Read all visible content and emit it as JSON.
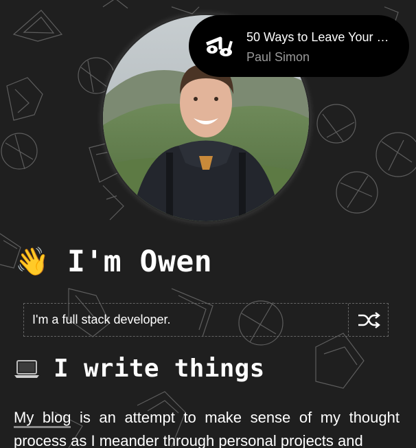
{
  "now_playing": {
    "title": "50 Ways to Leave Your …",
    "artist": "Paul Simon",
    "icon": "music-note-icon"
  },
  "hero": {
    "wave_emoji": "👋",
    "heading": "I'm Owen"
  },
  "intro": {
    "text": "I'm a full stack developer.",
    "shuffle_icon": "shuffle-icon"
  },
  "writing": {
    "emoji_icon": "laptop-icon",
    "heading": "I write things",
    "link_text": "My blog",
    "paragraph_rest": " is an attempt to make sense of my thought process as I meander through personal projects and"
  },
  "colors": {
    "background": "#1f1f1f",
    "pill": "#000000",
    "artist_text": "#9a9a9a",
    "pattern_stroke": "#5e5e5e"
  }
}
